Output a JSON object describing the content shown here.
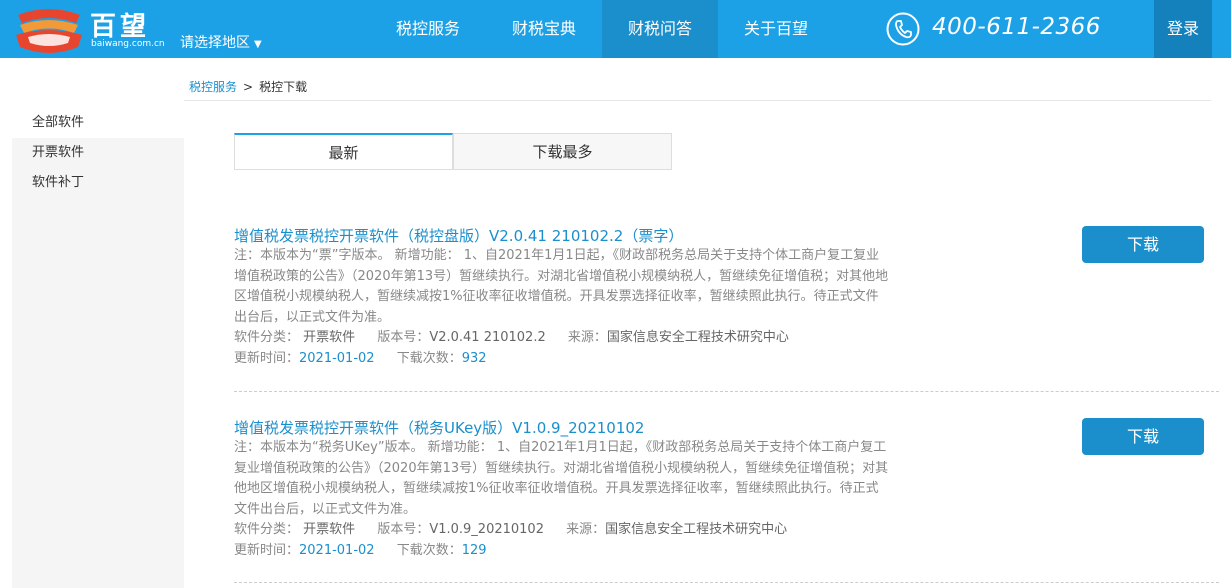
{
  "header": {
    "brand_name": "百望",
    "brand_domain": "baiwang.com.cn",
    "region": "请选择地区",
    "region_arrow": "▼",
    "nav": [
      {
        "label": "税控服务"
      },
      {
        "label": "财税宝典"
      },
      {
        "label": "财税问答"
      },
      {
        "label": "关于百望"
      }
    ],
    "phone": "400-611-2366",
    "login": "登录"
  },
  "sidebar": {
    "items": [
      {
        "label": "全部软件"
      },
      {
        "label": "开票软件"
      },
      {
        "label": "软件补丁"
      }
    ]
  },
  "breadcrumb": {
    "parent": "税控服务",
    "separator": ">",
    "current": "税控下载"
  },
  "tabs": [
    {
      "label": "最新"
    },
    {
      "label": "下载最多"
    }
  ],
  "items": [
    {
      "title": "增值税发票税控开票软件（税控盘版）V2.0.41 210102.2（票字）",
      "description": "注：本版本为“票”字版本。 新增功能： 1、自2021年1月1日起，《财政部税务总局关于支持个体工商户复工复业增值税政策的公告》（2020年第13号）暂继续执行。对湖北省增值税小规模纳税人，暂继续免征增值税；对其他地区增值税小规模纳税人，暂继续减按1%征收率征收增值税。开具发票选择征收率，暂继续照此执行。待正式文件出台后，以正式文件为准。",
      "category_label": "软件分类：",
      "category": "开票软件",
      "version_label": "版本号：",
      "version": "V2.0.41 210102.2",
      "source_label": "来源：",
      "source": "国家信息安全工程技术研究中心",
      "updated_label": "更新时间：",
      "updated": "2021-01-02",
      "downloads_label": "下载次数：",
      "downloads": "932",
      "button": "下载"
    },
    {
      "title": "增值税发票税控开票软件（税务UKey版）V1.0.9_20210102",
      "description": "注：本版本为“税务UKey”版本。 新增功能： 1、自2021年1月1日起，《财政部税务总局关于支持个体工商户复工复业增值税政策的公告》（2020年第13号）暂继续执行。对湖北省增值税小规模纳税人，暂继续免征增值税；对其他地区增值税小规模纳税人，暂继续减按1%征收率征收增值税。开具发票选择征收率，暂继续照此执行。待正式文件出台后，以正式文件为准。",
      "category_label": "软件分类：",
      "category": "开票软件",
      "version_label": "版本号：",
      "version": "V1.0.9_20210102",
      "source_label": "来源：",
      "source": "国家信息安全工程技术研究中心",
      "updated_label": "更新时间：",
      "updated": "2021-01-02",
      "downloads_label": "下载次数：",
      "downloads": "129",
      "button": "下载"
    }
  ],
  "icons": {
    "logo": "stacked-tray-logo-icon",
    "phone": "phone-icon"
  },
  "colors": {
    "header_bg": "#1da1e6",
    "nav_active": "#1b8fcc",
    "login_bg": "#1480bc",
    "link": "#1b8fcc",
    "logo_red": "#e8452f",
    "logo_orange": "#f19a37"
  }
}
